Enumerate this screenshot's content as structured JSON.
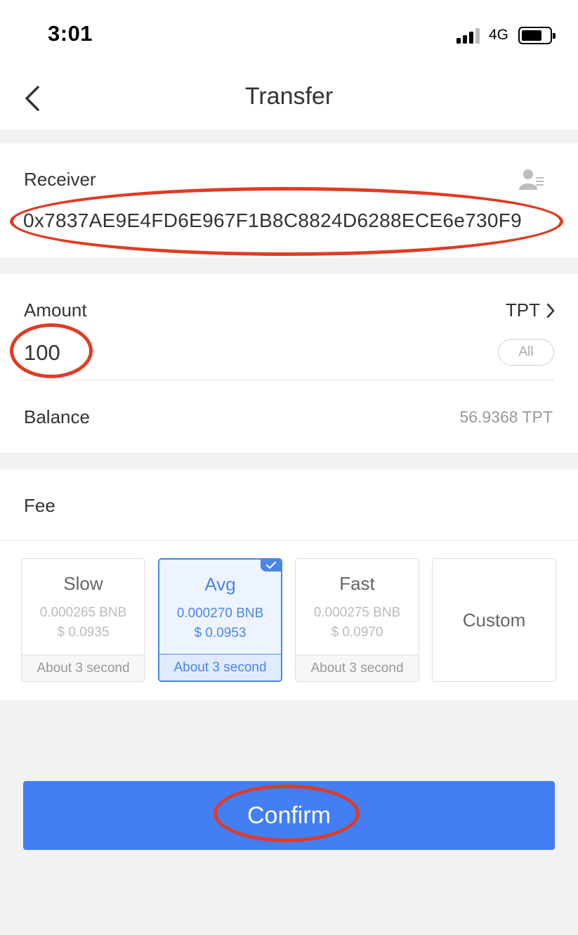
{
  "status_bar": {
    "time": "3:01",
    "network": "4G"
  },
  "nav": {
    "title": "Transfer"
  },
  "receiver": {
    "label": "Receiver",
    "address": "0x7837AE9E4FD6E967F1B8C8824D6288ECE6e730F9"
  },
  "amount": {
    "label": "Amount",
    "token": "TPT",
    "value": "100",
    "all_label": "All",
    "balance_label": "Balance",
    "balance_value": "56.9368 TPT"
  },
  "fee": {
    "label": "Fee",
    "options": [
      {
        "name": "Slow",
        "bnb": "0.000265 BNB",
        "usd": "$ 0.0935",
        "time": "About 3 second",
        "selected": false
      },
      {
        "name": "Avg",
        "bnb": "0.000270 BNB",
        "usd": "$ 0.0953",
        "time": "About 3 second",
        "selected": true
      },
      {
        "name": "Fast",
        "bnb": "0.000275 BNB",
        "usd": "$ 0.0970",
        "time": "About 3 second",
        "selected": false
      },
      {
        "name": "Custom"
      }
    ]
  },
  "confirm_label": "Confirm",
  "colors": {
    "accent": "#437ef2",
    "highlight": "#e03b24",
    "selected_text": "#4a86e8"
  }
}
